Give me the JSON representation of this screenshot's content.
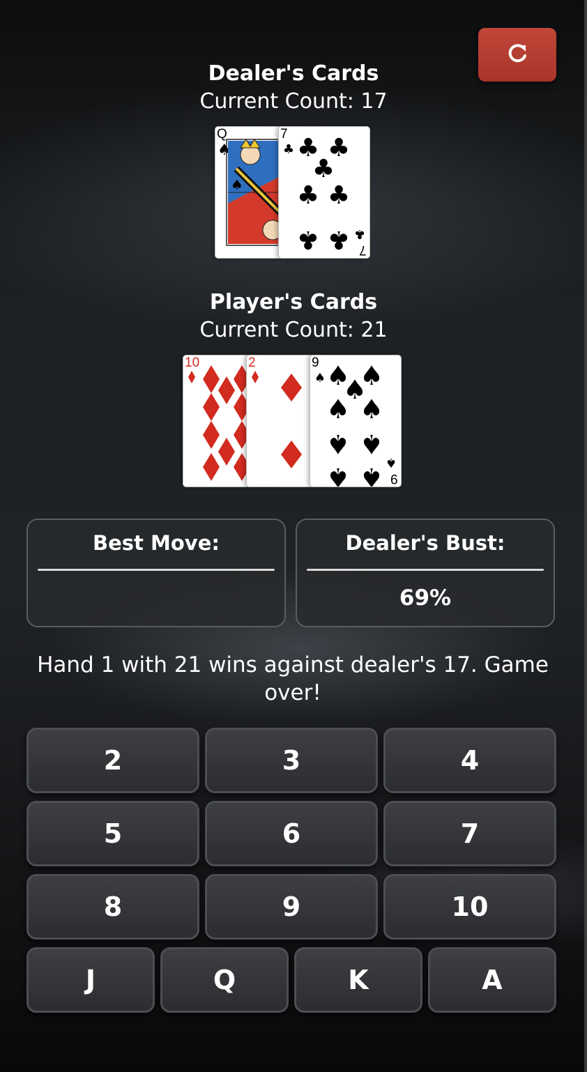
{
  "reset": {
    "icon": "refresh-icon"
  },
  "dealer": {
    "title": "Dealer's Cards",
    "count_label": "Current Count: 17",
    "cards": [
      {
        "rank": "Q",
        "suit": "spades",
        "color": "#000000"
      },
      {
        "rank": "7",
        "suit": "clubs",
        "color": "#000000"
      }
    ]
  },
  "player": {
    "title": "Player's Cards",
    "count_label": "Current Count: 21",
    "cards": [
      {
        "rank": "10",
        "suit": "diamonds",
        "color": "#d22b1f"
      },
      {
        "rank": "2",
        "suit": "diamonds",
        "color": "#d22b1f"
      },
      {
        "rank": "9",
        "suit": "spades",
        "color": "#000000"
      }
    ]
  },
  "best_move": {
    "label": "Best Move:",
    "value": ""
  },
  "dealer_bust": {
    "label": "Dealer's Bust:",
    "value": "69%"
  },
  "message": "Hand 1 with 21 wins against dealer's 17. Game over!",
  "keypad": {
    "row1": [
      "2",
      "3",
      "4"
    ],
    "row2": [
      "5",
      "6",
      "7"
    ],
    "row3": [
      "8",
      "9",
      "10"
    ],
    "row4": [
      "J",
      "Q",
      "K",
      "A"
    ]
  },
  "colors": {
    "accent_red": "#b83b2f",
    "diamond_red": "#d22b1f"
  }
}
